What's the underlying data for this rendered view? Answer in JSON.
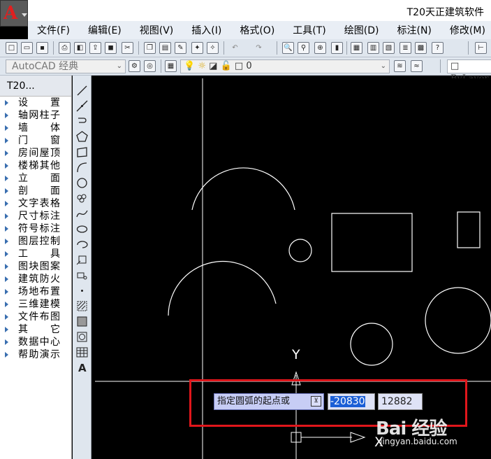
{
  "window": {
    "title": "T20天正建筑软件"
  },
  "menu": [
    "文件(F)",
    "编辑(E)",
    "视图(V)",
    "插入(I)",
    "格式(O)",
    "工具(T)",
    "绘图(D)",
    "标注(N)",
    "修改(M)"
  ],
  "toolbar": {
    "workspace": "AutoCAD 经典",
    "layer_value": "0",
    "linetype": "ByLayer"
  },
  "palette": {
    "title": "T20...",
    "items": [
      "设　　置",
      "轴网柱子",
      "墙　　体",
      "门　　窗",
      "房间屋顶",
      "楼梯其他",
      "立　　面",
      "剖　　面",
      "文字表格",
      "尺寸标注",
      "符号标注",
      "图层控制",
      "工　　具",
      "图块图案",
      "建筑防火",
      "场地布置",
      "三维建模",
      "文件布图",
      "其　　它",
      "数据中心",
      "帮助演示"
    ]
  },
  "command": {
    "prompt": "指定圆弧的起点或",
    "x_value": "-20830",
    "y_value": "12882"
  },
  "ucs": {
    "y_label": "Y",
    "x_label": "X"
  },
  "watermark": {
    "brand": "Bai 经验",
    "url": "jingyan.baidu.com"
  },
  "colors": {
    "highlight_border": "#e0161b",
    "selection": "#1b5fd6"
  }
}
